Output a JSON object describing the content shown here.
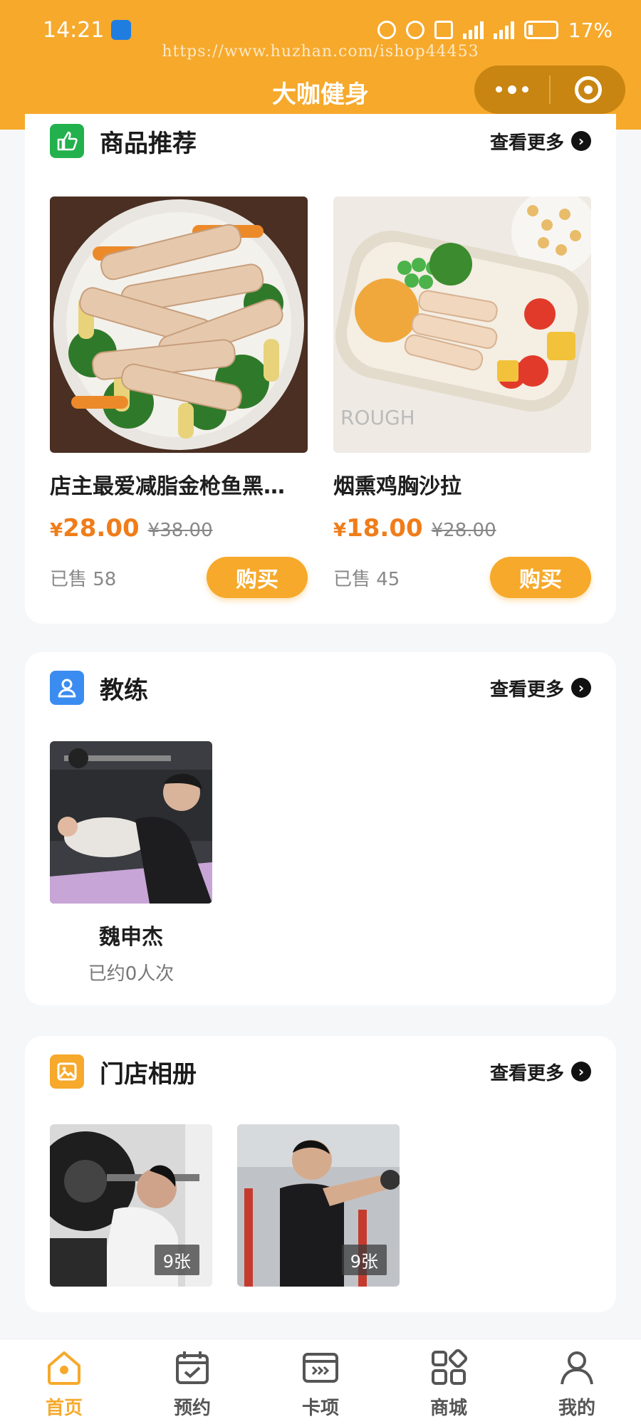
{
  "status_bar": {
    "time": "14:21",
    "battery": "17%",
    "network": "4G"
  },
  "watermark": "https://www.huzhan.com/ishop44453",
  "app_title": "大咖健身",
  "colors": {
    "accent": "#f6a92b",
    "price": "#ef7d1a",
    "recommend_icon": "#22b14c",
    "coach_icon": "#3b8cf0",
    "album_icon": "#f6a92b"
  },
  "recommend": {
    "title": "商品推荐",
    "more": "查看更多",
    "products": [
      {
        "name": "店主最爱减脂金枪鱼黑…",
        "currency": "¥",
        "price": "28.00",
        "original_price": "¥38.00",
        "sold": "已售 58",
        "buy": "购买"
      },
      {
        "name": "烟熏鸡胸沙拉",
        "currency": "¥",
        "price": "18.00",
        "original_price": "¥28.00",
        "sold": "已售 45",
        "buy": "购买"
      }
    ]
  },
  "coach": {
    "title": "教练",
    "more": "查看更多",
    "items": [
      {
        "name": "魏申杰",
        "booked": "已约0人次"
      }
    ]
  },
  "album": {
    "title": "门店相册",
    "more": "查看更多",
    "items": [
      {
        "count": "9张"
      },
      {
        "count": "9张"
      }
    ]
  },
  "tabbar": [
    {
      "label": "首页",
      "icon": "home-icon",
      "active": true
    },
    {
      "label": "预约",
      "icon": "calendar-icon",
      "active": false
    },
    {
      "label": "卡项",
      "icon": "card-icon",
      "active": false
    },
    {
      "label": "商城",
      "icon": "grid-icon",
      "active": false
    },
    {
      "label": "我的",
      "icon": "user-icon",
      "active": false
    }
  ]
}
